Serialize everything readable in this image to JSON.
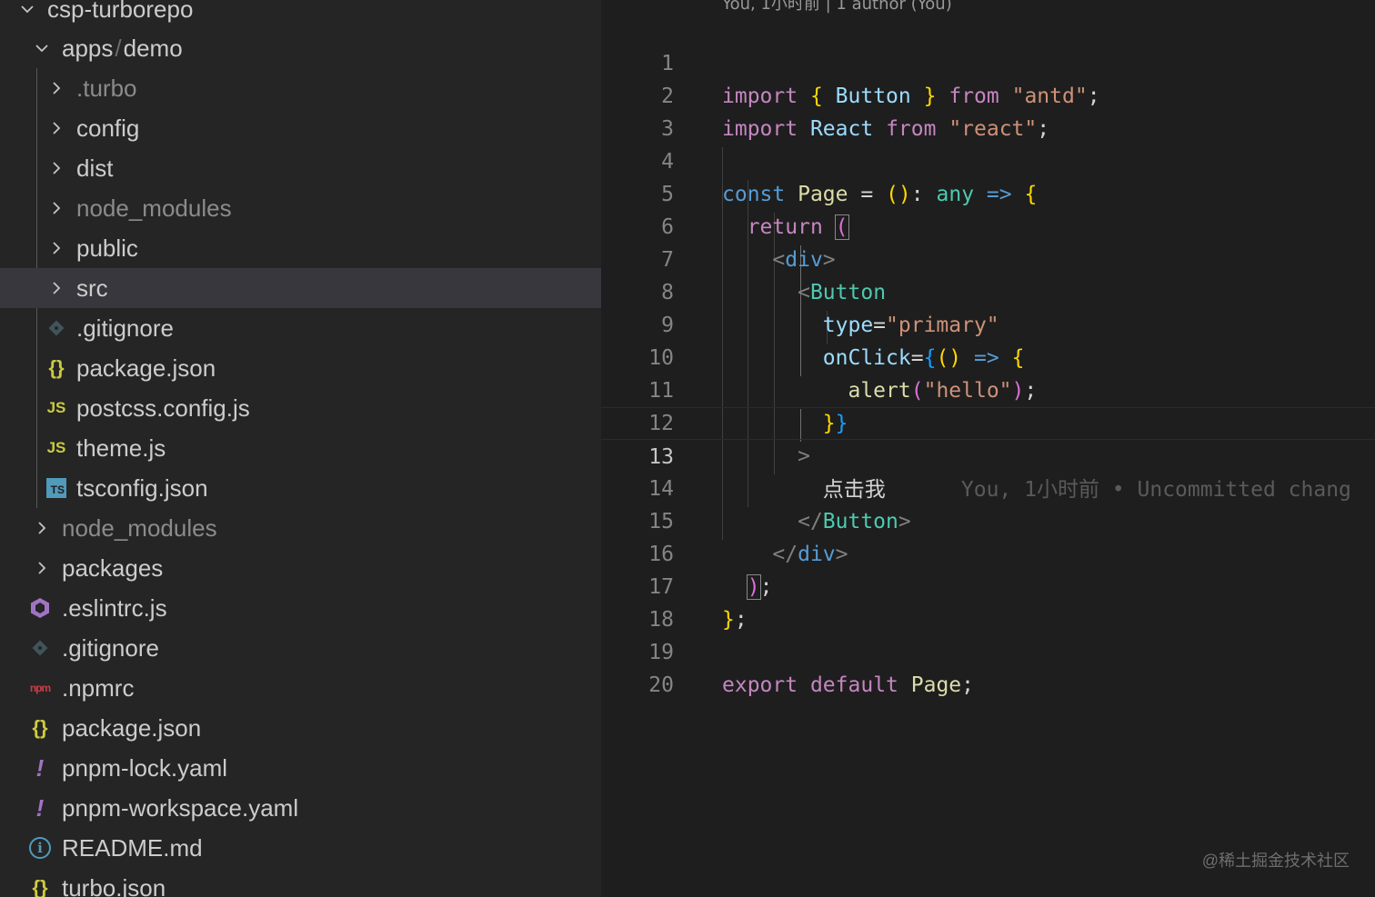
{
  "explorer": {
    "root": "csp-turborepo",
    "items": [
      {
        "label": "apps",
        "label_suffix": "demo",
        "type": "folder",
        "expanded": true
      },
      {
        "label": ".turbo",
        "type": "folder",
        "dim": true
      },
      {
        "label": "config",
        "type": "folder"
      },
      {
        "label": "dist",
        "type": "folder"
      },
      {
        "label": "node_modules",
        "type": "folder",
        "dim": true
      },
      {
        "label": "public",
        "type": "folder"
      },
      {
        "label": "src",
        "type": "folder",
        "selected": true
      },
      {
        "label": ".gitignore",
        "type": "git"
      },
      {
        "label": "package.json",
        "type": "json"
      },
      {
        "label": "postcss.config.js",
        "type": "js"
      },
      {
        "label": "theme.js",
        "type": "js"
      },
      {
        "label": "tsconfig.json",
        "type": "ts"
      },
      {
        "label": "node_modules",
        "type": "folder",
        "dim": true
      },
      {
        "label": "packages",
        "type": "folder"
      },
      {
        "label": ".eslintrc.js",
        "type": "eslint"
      },
      {
        "label": ".gitignore",
        "type": "git"
      },
      {
        "label": ".npmrc",
        "type": "npm"
      },
      {
        "label": "package.json",
        "type": "json"
      },
      {
        "label": "pnpm-lock.yaml",
        "type": "yaml"
      },
      {
        "label": "pnpm-workspace.yaml",
        "type": "yaml"
      },
      {
        "label": "README.md",
        "type": "info"
      },
      {
        "label": "turbo.json",
        "type": "json"
      }
    ],
    "icons": {
      "chevron_right": "›",
      "json": "{}",
      "js": "JS",
      "ts": "TS",
      "npm": "npm",
      "yaml": "!",
      "info": "i"
    }
  },
  "editor": {
    "codelens": "You, 1小时前 | 1 author (You)",
    "line_numbers": [
      "1",
      "2",
      "3",
      "4",
      "5",
      "6",
      "7",
      "8",
      "9",
      "10",
      "11",
      "12",
      "13",
      "14",
      "15",
      "16",
      "17",
      "18",
      "19",
      "20"
    ],
    "current_line": "13",
    "tokens": {
      "import": "import",
      "from": "from",
      "Button": "Button",
      "React": "React",
      "antd": "\"antd\"",
      "react": "\"react\"",
      "const": "const",
      "Page": "Page",
      "any": "any",
      "return": "return",
      "div": "div",
      "type": "type",
      "primary": "\"primary\"",
      "onClick": "onClick",
      "alert": "alert",
      "hello": "\"hello\"",
      "text": "点击我",
      "export": "export",
      "default": "default"
    },
    "blame": "You, 1小时前 • Uncommitted chang"
  },
  "watermark": "@稀土掘金技术社区",
  "colors": {
    "sidebar_bg": "#252526",
    "editor_bg": "#1e1e1e",
    "selected_row": "#37373d",
    "keyword": "#c586c0",
    "string": "#ce9178",
    "type": "#4ec9b0"
  }
}
